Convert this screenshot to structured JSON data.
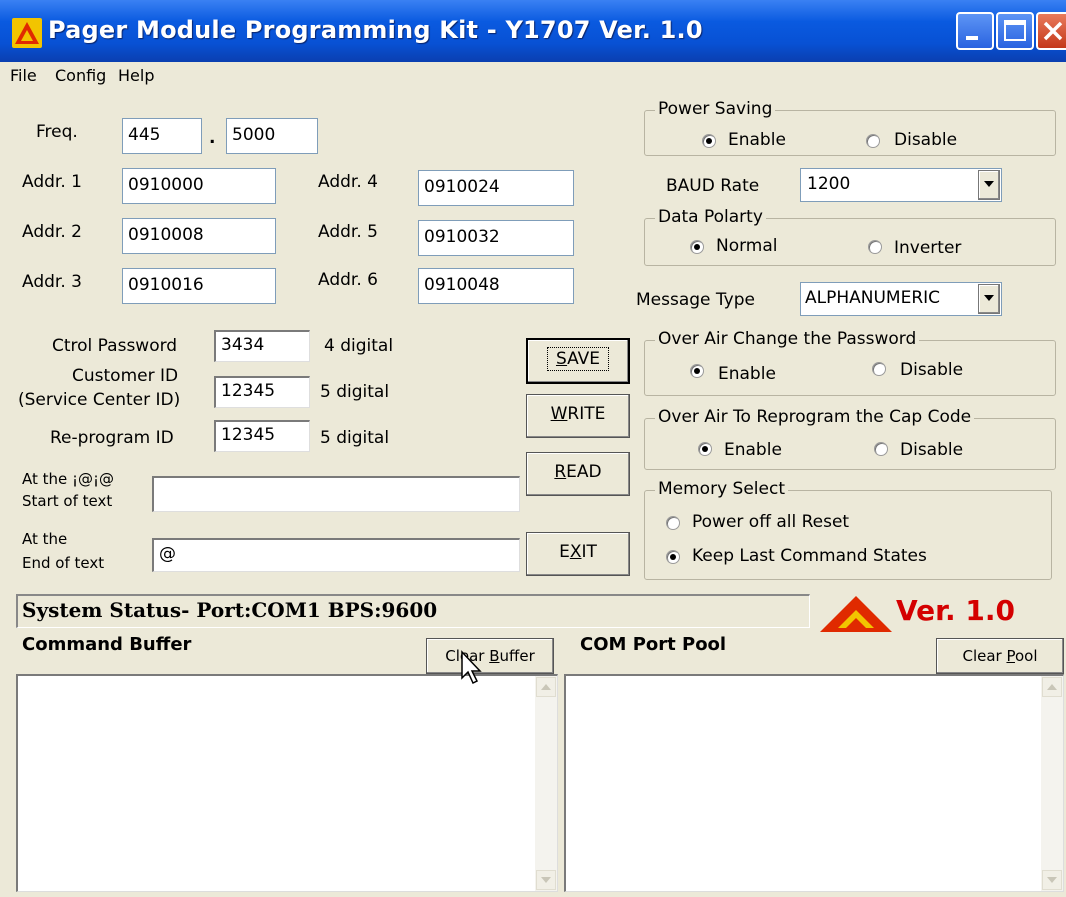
{
  "window": {
    "title": "Pager Module Programming Kit - Y1707 Ver. 1.0"
  },
  "menu": {
    "file": "File",
    "config": "Config",
    "help": "Help"
  },
  "freq": {
    "label": "Freq.",
    "int_value": "445",
    "dot": ".",
    "frac_value": "5000"
  },
  "addresses": {
    "addr1": {
      "label": "Addr. 1",
      "value": "0910000"
    },
    "addr2": {
      "label": "Addr. 2",
      "value": "0910008"
    },
    "addr3": {
      "label": "Addr. 3",
      "value": "0910016"
    },
    "addr4": {
      "label": "Addr. 4",
      "value": "0910024"
    },
    "addr5": {
      "label": "Addr. 5",
      "value": "0910032"
    },
    "addr6": {
      "label": "Addr. 6",
      "value": "0910048"
    }
  },
  "ids": {
    "ctrl_password": {
      "label": "Ctrol Password",
      "value": "3434",
      "hint": "4 digital"
    },
    "customer_id": {
      "label_line1": "Customer ID",
      "label_line2": "(Service Center ID)",
      "value": "12345",
      "hint": "5 digital"
    },
    "reprogram_id": {
      "label": "Re-program ID",
      "value": "12345",
      "hint": "5 digital"
    }
  },
  "text_markers": {
    "start": {
      "label_line1": "At the ¡@¡@",
      "label_line2": "Start of text",
      "value": ""
    },
    "end": {
      "label_line1": "At the",
      "label_line2": "End of text",
      "value": "@"
    }
  },
  "buttons": {
    "save": {
      "pre": "",
      "key": "S",
      "post": "AVE"
    },
    "write": {
      "pre": "",
      "key": "W",
      "post": "RITE"
    },
    "read": {
      "pre": "",
      "key": "R",
      "post": "EAD"
    },
    "exit": {
      "pre": "E",
      "key": "X",
      "post": "IT"
    },
    "clear_buffer": {
      "pre": "Clear ",
      "key": "B",
      "post": "uffer"
    },
    "clear_pool": {
      "pre": "Clear ",
      "key": "P",
      "post": "ool"
    }
  },
  "power_saving": {
    "title": "Power Saving",
    "enable": "Enable",
    "disable": "Disable",
    "selected": "enable"
  },
  "baud_rate": {
    "label": "BAUD Rate",
    "value": "1200"
  },
  "data_polarity": {
    "title": "Data Polarty",
    "normal": "Normal",
    "inverter": "Inverter",
    "selected": "normal"
  },
  "message_type": {
    "label": "Message Type",
    "value": "ALPHANUMERIC"
  },
  "ota_password": {
    "title": "Over Air Change the Password",
    "enable": "Enable",
    "disable": "Disable",
    "selected": "enable"
  },
  "ota_capcode": {
    "title": "Over Air To Reprogram the Cap Code",
    "enable": "Enable",
    "disable": "Disable",
    "selected": "enable"
  },
  "memory_select": {
    "title": "Memory Select",
    "option1": "Power off all Reset",
    "option2": "Keep Last Command States",
    "selected": "option2"
  },
  "status": {
    "text": "System Status- Port:COM1 BPS:9600",
    "version": "Ver. 1.0"
  },
  "panels": {
    "command_buffer": "Command Buffer",
    "com_port_pool": "COM Port Pool"
  },
  "colors": {
    "title_bar": "#0a5ae0",
    "version_red": "#d40000",
    "logo_red": "#e02a00",
    "logo_yellow": "#f2c400"
  }
}
